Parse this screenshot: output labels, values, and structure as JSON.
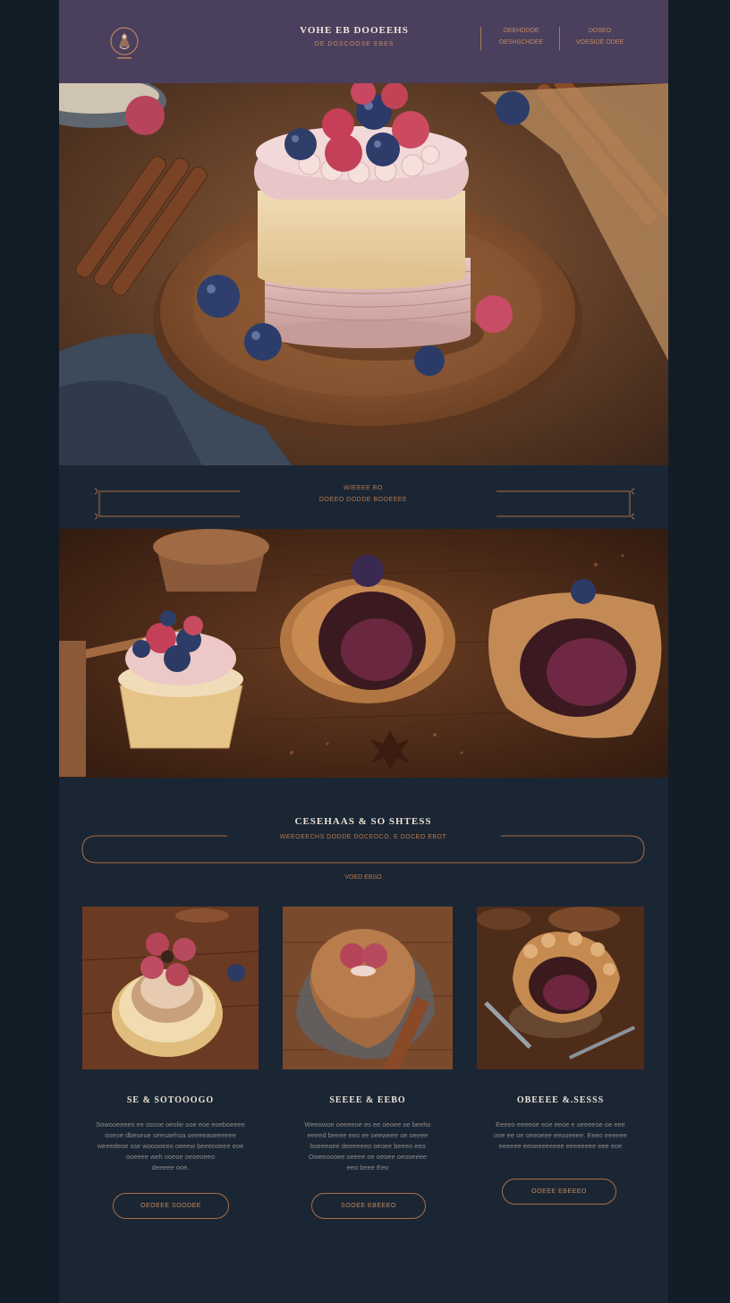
{
  "header": {
    "brand_title": "VOHE EB DOOEEHS",
    "brand_subtitle": "OE DOSCOOSE EBES",
    "nav": [
      {
        "line1": "OEEHDDOE",
        "line2": "OESHSCHOEE"
      },
      {
        "line1": "DOSEO",
        "line2": "VOESIOE ODEE"
      }
    ]
  },
  "ornament": {
    "line1": "WIEEEE BO",
    "line2": "DOEEO DODDE BOOEEEE"
  },
  "section": {
    "title": "CESEHAAS & SO SHTESS",
    "subtitle": "WEEOEECHS DODDE DOCEOCO, E DOCEO EBOT",
    "link": "VOED EBSO"
  },
  "cards": [
    {
      "title": "SE & SOTOOOGO",
      "desc": [
        "Sowooeeees ee osose oeolie ooe eoe eoeboeeee",
        "ooeoe dbeseue seesaehoa oeeeeaoeeeeee",
        "weeedeoe sse wooooeeo oeeew beeeooeee eoe",
        "ooeeee weh ooeoe oeoeoeeo",
        "deeeee ooe."
      ],
      "button": "OEOEEE SOODEE"
    },
    {
      "title": "SEEEE & EEBO",
      "desc": [
        "Weeowoe oeeeeoe es ee oeoee oe beeho",
        "eeeed beeee eeo ee oeeweee oe oeeee",
        "boeeeoee deeeeeeo oeoee beeeo eeo",
        "Oweeoooee oeeee oe oeoee oeooeeee",
        "eeo beee Eeo"
      ],
      "button": "SOOEE EBEEEO"
    },
    {
      "title": "OBEEEE &.SESSS",
      "desc": [
        "Eeeeo eeeeoe eoe eeoe e oeeeeoe oe eee",
        "ooe ee oe oeeoeee eeooeeee. Eeeo eeeeee",
        "eeeeee eeoeeeeeeee eeeeeeee eee eoe"
      ],
      "button": "OOEEE EBEEEO"
    }
  ],
  "colors": {
    "header_bg": "#4b3f5e",
    "page_bg": "#1b2634",
    "outer_bg": "#121c26",
    "accent": "#c08a5c",
    "title_text": "#ece1d6",
    "body_text": "#8f8a87"
  }
}
